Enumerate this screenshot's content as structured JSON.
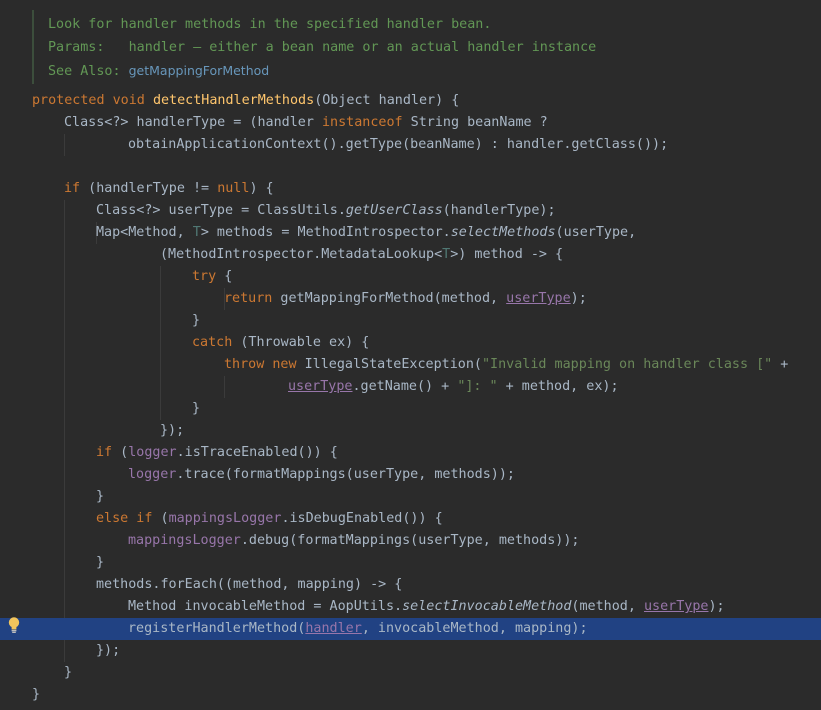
{
  "doc": {
    "summary": "Look for handler methods in the specified handler bean.",
    "params_label": "Params:",
    "params_text": "handler – either a bean name or an actual handler instance",
    "see_also_label": "See Also:",
    "see_also_link": "getMappingForMethod"
  },
  "code": {
    "l1": [
      "protected void ",
      "detectHandlerMethods",
      "(Object handler) {"
    ],
    "l2": [
      "Class<?> handlerType = (handler ",
      "instanceof",
      " String beanName ?"
    ],
    "l3": [
      "obtainApplicationContext().getType(beanName) : handler.getClass());"
    ],
    "l5": [
      "if",
      " (handlerType != ",
      "null",
      ") {"
    ],
    "l6": [
      "Class<?> userType = ClassUtils.",
      "getUserClass",
      "(handlerType);"
    ],
    "l7": [
      "Map<Method, ",
      "T",
      "> methods = MethodIntrospector.",
      "selectMethods",
      "(userType,"
    ],
    "l8": [
      "(MethodIntrospector.MetadataLookup<",
      "T",
      ">) method -> {"
    ],
    "l9": [
      "try",
      " {"
    ],
    "l10": [
      "return",
      " getMappingForMethod(method, ",
      "userType",
      ");"
    ],
    "l11": [
      "}"
    ],
    "l12": [
      "catch",
      " (Throwable ex) {"
    ],
    "l13": [
      "throw new",
      " IllegalStateException(",
      "\"Invalid mapping on handler class [\"",
      " +"
    ],
    "l14": [
      "userType",
      ".getName() + ",
      "\"]: \"",
      " + method, ex);"
    ],
    "l15": [
      "}"
    ],
    "l16": [
      "});"
    ],
    "l17": [
      "if",
      " (",
      "logger",
      ".isTraceEnabled()) {"
    ],
    "l18": [
      "logger",
      ".trace(formatMappings(userType, methods));"
    ],
    "l19": [
      "}"
    ],
    "l20": [
      "else if",
      " (",
      "mappingsLogger",
      ".isDebugEnabled()) {"
    ],
    "l21": [
      "mappingsLogger",
      ".debug(formatMappings(userType, methods));"
    ],
    "l22": [
      "}"
    ],
    "l23": [
      "methods.forEach((method, mapping) -> {"
    ],
    "l24": [
      "Method invocableMethod = AopUtils.",
      "selectInvocableMethod",
      "(method, ",
      "userType",
      ");"
    ],
    "l25": [
      "registerHandlerMethod(",
      "handler",
      ", invocableMethod, mapping);"
    ],
    "l26": [
      "});"
    ],
    "l27": [
      "}"
    ],
    "l28": [
      "}"
    ]
  },
  "colors": {
    "background": "#2b2b2b",
    "keyword": "#cc7832",
    "method_decl": "#ffc66d",
    "string": "#6a8759",
    "field": "#9876aa",
    "doc_comment": "#629755",
    "selection": "#214283"
  },
  "gutter": {
    "intention_icon": "lightbulb-icon"
  }
}
